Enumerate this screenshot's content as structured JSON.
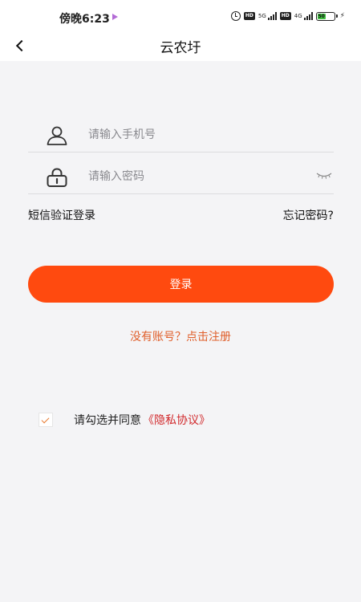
{
  "status_bar": {
    "time": "傍晚6:23",
    "hd_label": "HD",
    "network_5g": "5G",
    "network_4g": "4G",
    "battery": "50",
    "battery_level": 0.5,
    "icons": [
      "alarm-icon",
      "signal-icon",
      "battery-icon",
      "charging-bolt-icon"
    ]
  },
  "header": {
    "title": "云农圩",
    "back_icon": "chevron-left-icon"
  },
  "form": {
    "phone": {
      "placeholder": "请输入手机号",
      "value": "",
      "icon": "user-icon"
    },
    "password": {
      "placeholder": "请输入密码",
      "value": "",
      "icon": "lock-icon",
      "toggle_icon": "eye-closed-icon"
    },
    "sms_login": "短信验证登录",
    "forgot_password": "忘记密码?",
    "login_button": "登录",
    "register": "没有账号？点击注册"
  },
  "agreement": {
    "checked": true,
    "prefix": "请勾选并同意",
    "link": "《隐私协议》"
  },
  "colors": {
    "primary": "#ff4a0f",
    "register_link": "#e05f2b",
    "privacy_link": "#d1282b",
    "background": "#f4f4f6"
  }
}
